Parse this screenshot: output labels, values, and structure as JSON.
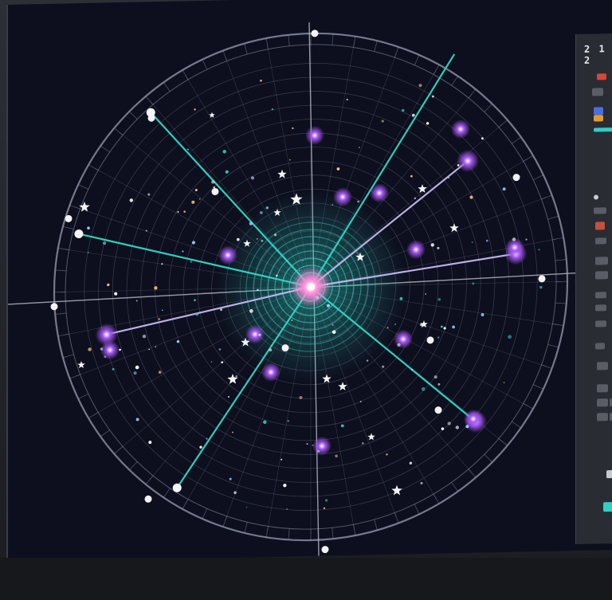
{
  "window": {
    "title": ""
  },
  "panel": {
    "clock_text": "2 1 2",
    "accent_color": "#2ecfc4",
    "alert_color": "#d8463a",
    "warn_color": "#e29a2e"
  },
  "radar": {
    "beam_color": "#31d8c6",
    "node_color": "#a456f0",
    "ring_color": "#8e93a8",
    "core_color": "#ff8ad8"
  }
}
